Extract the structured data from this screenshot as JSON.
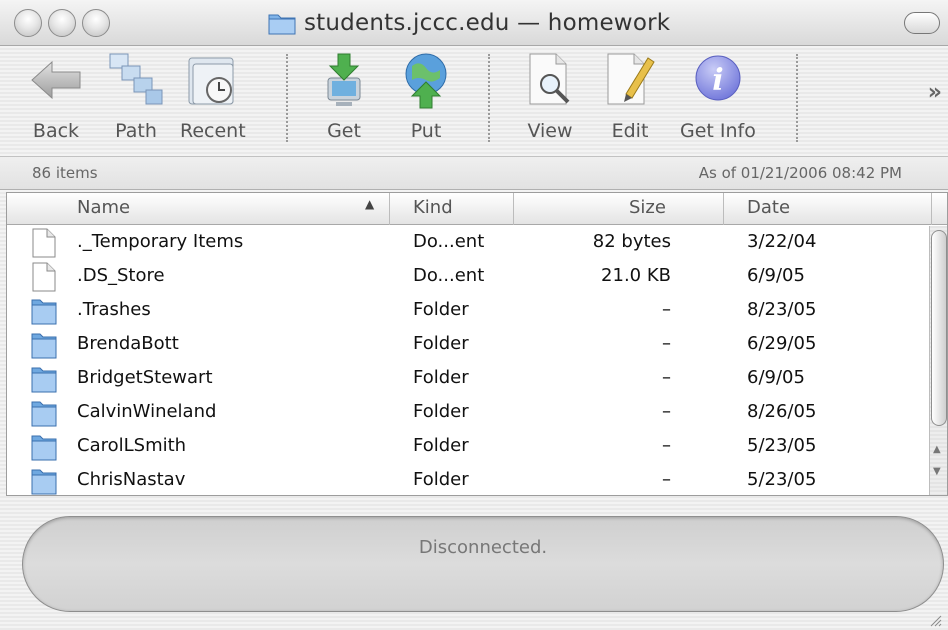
{
  "window": {
    "title": "students.jccc.edu — homework"
  },
  "toolbar": {
    "back_label": "Back",
    "path_label": "Path",
    "recent_label": "Recent",
    "get_label": "Get",
    "put_label": "Put",
    "view_label": "View",
    "edit_label": "Edit",
    "getinfo_label": "Get Info",
    "overflow_label": "»"
  },
  "status": {
    "item_count": "86 items",
    "as_of": "As of 01/21/2006 08:42 PM"
  },
  "list": {
    "headers": {
      "name": "Name",
      "kind": "Kind",
      "size": "Size",
      "date": "Date"
    },
    "rows": [
      {
        "name": "._Temporary Items",
        "kind": "Do...ent",
        "size": "82 bytes",
        "date": "3/22/04",
        "icon": "document-icon"
      },
      {
        "name": ".DS_Store",
        "kind": "Do...ent",
        "size": "21.0 KB",
        "date": "6/9/05",
        "icon": "document-icon"
      },
      {
        "name": ".Trashes",
        "kind": "Folder",
        "size": "–",
        "date": "8/23/05",
        "icon": "folder-icon"
      },
      {
        "name": "BrendaBott",
        "kind": "Folder",
        "size": "–",
        "date": "6/29/05",
        "icon": "folder-icon"
      },
      {
        "name": "BridgetStewart",
        "kind": "Folder",
        "size": "–",
        "date": "6/9/05",
        "icon": "folder-icon"
      },
      {
        "name": "CalvinWineland",
        "kind": "Folder",
        "size": "–",
        "date": "8/26/05",
        "icon": "folder-icon"
      },
      {
        "name": "CarolLSmith",
        "kind": "Folder",
        "size": "–",
        "date": "5/23/05",
        "icon": "folder-icon"
      },
      {
        "name": "ChrisNastav",
        "kind": "Folder",
        "size": "–",
        "date": "5/23/05",
        "icon": "folder-icon"
      }
    ]
  },
  "footer": {
    "connection_status": "Disconnected."
  },
  "colors": {
    "folder_blue": "#6fa8e0",
    "info_purple": "#8a8fe0",
    "get_green": "#4fb04f"
  }
}
